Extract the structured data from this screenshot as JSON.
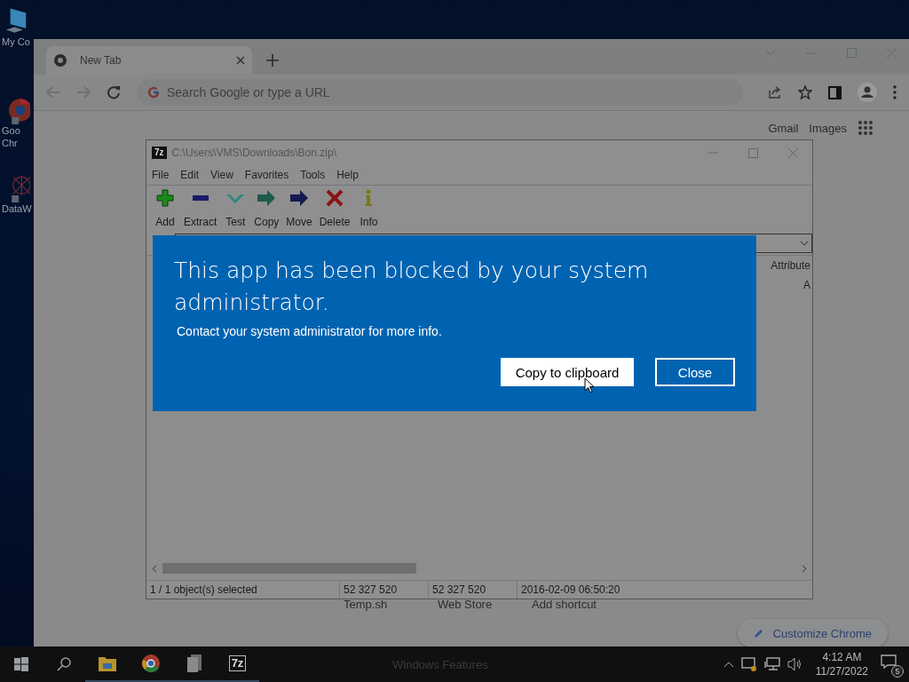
{
  "desktop_icons": [
    {
      "kind": "computer",
      "lines": [
        "My Co"
      ]
    },
    {
      "kind": "browser",
      "lines": [
        "Goo",
        "Chr"
      ]
    },
    {
      "kind": "web",
      "lines": [
        "DataW"
      ]
    }
  ],
  "browser": {
    "tabs": [
      {
        "title": "New Tab",
        "selected": true
      }
    ],
    "omnibox": {
      "placeholder": "Search Google or type a URL"
    },
    "links": [
      "Gmail",
      "Images"
    ],
    "shortcuts": [
      "Temp.sh",
      "Web Store",
      "Add shortcut"
    ],
    "customize": "Customize Chrome"
  },
  "archiver": {
    "app_icon": "7z",
    "title": "C:\\Users\\VMS\\Downloads\\Bon.zip\\",
    "menu": [
      "File",
      "Edit",
      "View",
      "Favorites",
      "Tools",
      "Help"
    ],
    "toolbar": [
      {
        "label": "Add",
        "kind": "add"
      },
      {
        "label": "Extract",
        "kind": "extract"
      },
      {
        "label": "Test",
        "kind": "test"
      },
      {
        "label": "Copy",
        "kind": "copy"
      },
      {
        "label": "Move",
        "kind": "move"
      },
      {
        "label": "Delete",
        "kind": "delete"
      },
      {
        "label": "Info",
        "kind": "info"
      }
    ],
    "column": "Attribute",
    "cell": "A",
    "status": [
      "1 / 1 object(s) selected",
      "52 327 520",
      "52 327 520",
      "2016-02-09 06:50:20"
    ]
  },
  "dialog": {
    "title": "This app has been blocked by your system administrator.",
    "message": "Contact your system administrator for more info.",
    "buttons": [
      {
        "label": "Copy to clipboard",
        "kind": "secondary"
      },
      {
        "label": "Close",
        "kind": "primary"
      }
    ]
  },
  "taskbar": {
    "apps": [
      {
        "kind": "explorer"
      },
      {
        "kind": "chrome"
      },
      {
        "kind": "files"
      },
      {
        "kind": "archiver",
        "label": "7z"
      }
    ],
    "window_label": "Windows Features",
    "time": "4:12 AM",
    "date": "11/27/2022",
    "notifications": "5"
  }
}
